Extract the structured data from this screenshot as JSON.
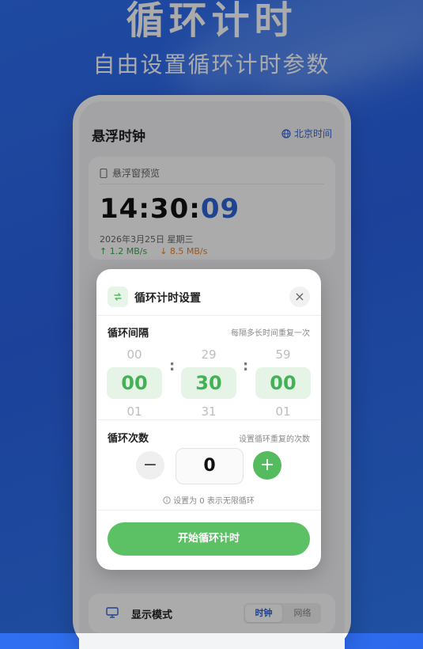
{
  "hero": {
    "title": "循环计时",
    "subtitle": "自由设置循环计时参数"
  },
  "app": {
    "title": "悬浮时钟",
    "timezone": "北京时间",
    "preview": {
      "label": "悬浮窗预览",
      "time_hm": "14:30:",
      "time_s": "09",
      "date": "2026年3月25日 星期三",
      "upload": "↑ 1.2 MB/s",
      "download": "↓ 8.5 MB/s"
    },
    "display_mode": {
      "label": "显示模式",
      "options": [
        "时钟",
        "网络"
      ],
      "selected": "时钟"
    }
  },
  "modal": {
    "title": "循环计时设置",
    "close": "×",
    "interval": {
      "label": "循环间隔",
      "hint": "每隔多长时间重复一次",
      "hours": {
        "prev": "00",
        "current": "00",
        "next": "01"
      },
      "minutes": {
        "prev": "29",
        "current": "30",
        "next": "31"
      },
      "seconds": {
        "prev": "59",
        "current": "00",
        "next": "01"
      }
    },
    "count": {
      "label": "循环次数",
      "hint": "设置循环重复的次数",
      "value": "0",
      "minus": "−",
      "plus": "+",
      "note": "设置为 0 表示无限循环"
    },
    "start_button": "开始循环计时"
  },
  "colors": {
    "accent_blue": "#2d64d8",
    "accent_green": "#55bb5f"
  }
}
